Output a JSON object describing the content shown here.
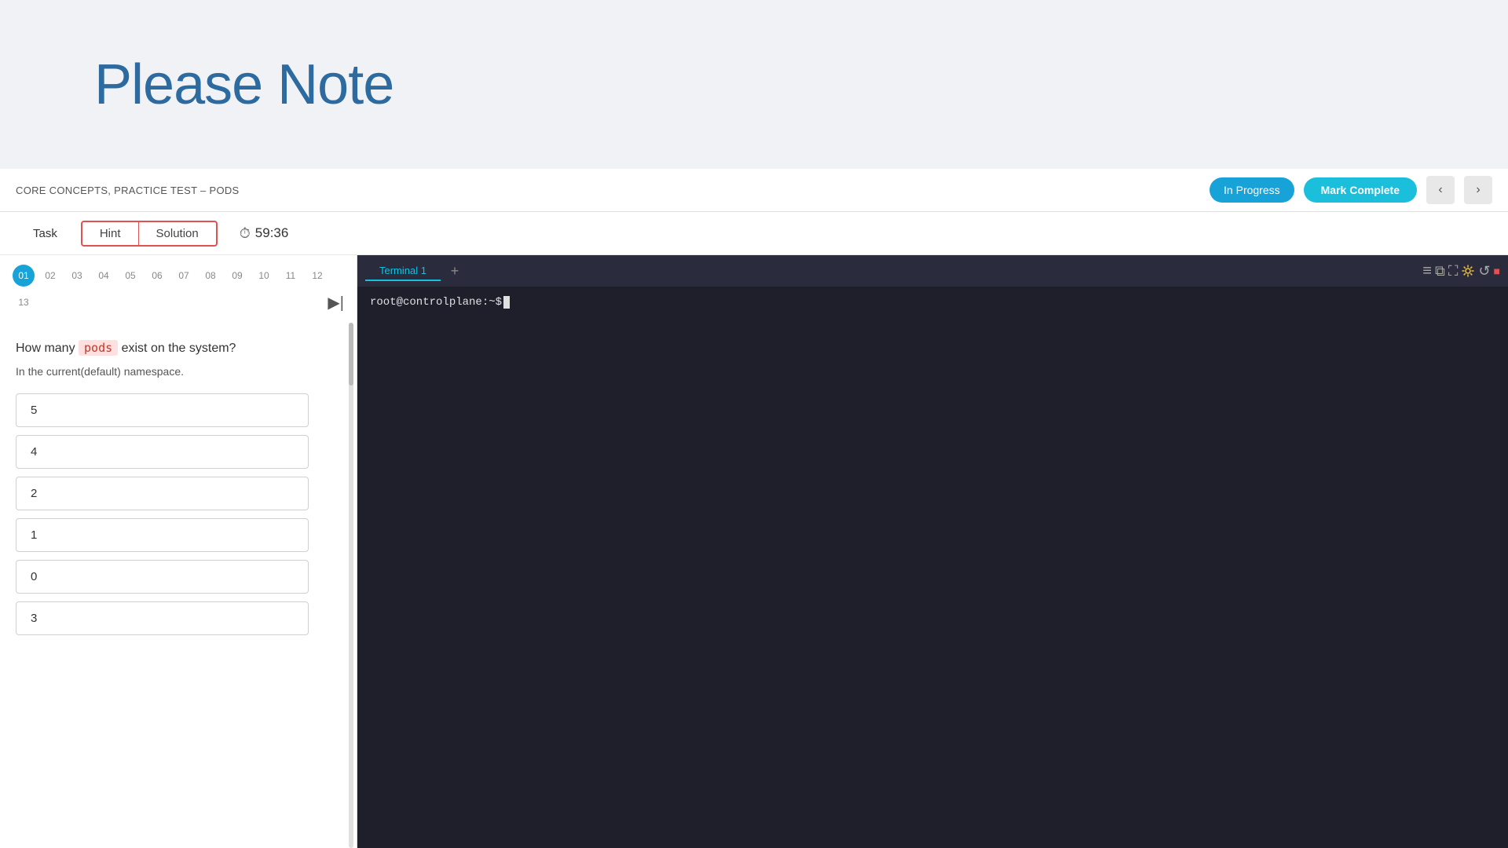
{
  "banner": {
    "title": "Please Note"
  },
  "navbar": {
    "breadcrumb": "CORE CONCEPTS, PRACTICE TEST – PODS",
    "in_progress_label": "In Progress",
    "mark_complete_label": "Mark Complete",
    "prev_arrow": "‹",
    "next_arrow": "›"
  },
  "tabs": {
    "task_label": "Task",
    "hint_label": "Hint",
    "solution_label": "Solution",
    "timer_label": "59:36"
  },
  "steps": {
    "numbers": [
      "01",
      "02",
      "03",
      "04",
      "05",
      "06",
      "07",
      "08",
      "09",
      "10",
      "11",
      "12",
      "13"
    ],
    "active_index": 0
  },
  "question": {
    "text_before": "How many ",
    "highlight": "pods",
    "text_after": " exist on the system?",
    "sub_text": "In the current(default) namespace.",
    "options": [
      "5",
      "4",
      "2",
      "1",
      "0",
      "3"
    ]
  },
  "terminal": {
    "tab_label": "Terminal 1",
    "add_tab": "+",
    "prompt": "root@controlplane:~$ ",
    "icons": {
      "menu": "≡",
      "popout": "⧉",
      "fullscreen": "⛶",
      "settings": "✦",
      "revert": "↺",
      "stop": "■"
    }
  }
}
